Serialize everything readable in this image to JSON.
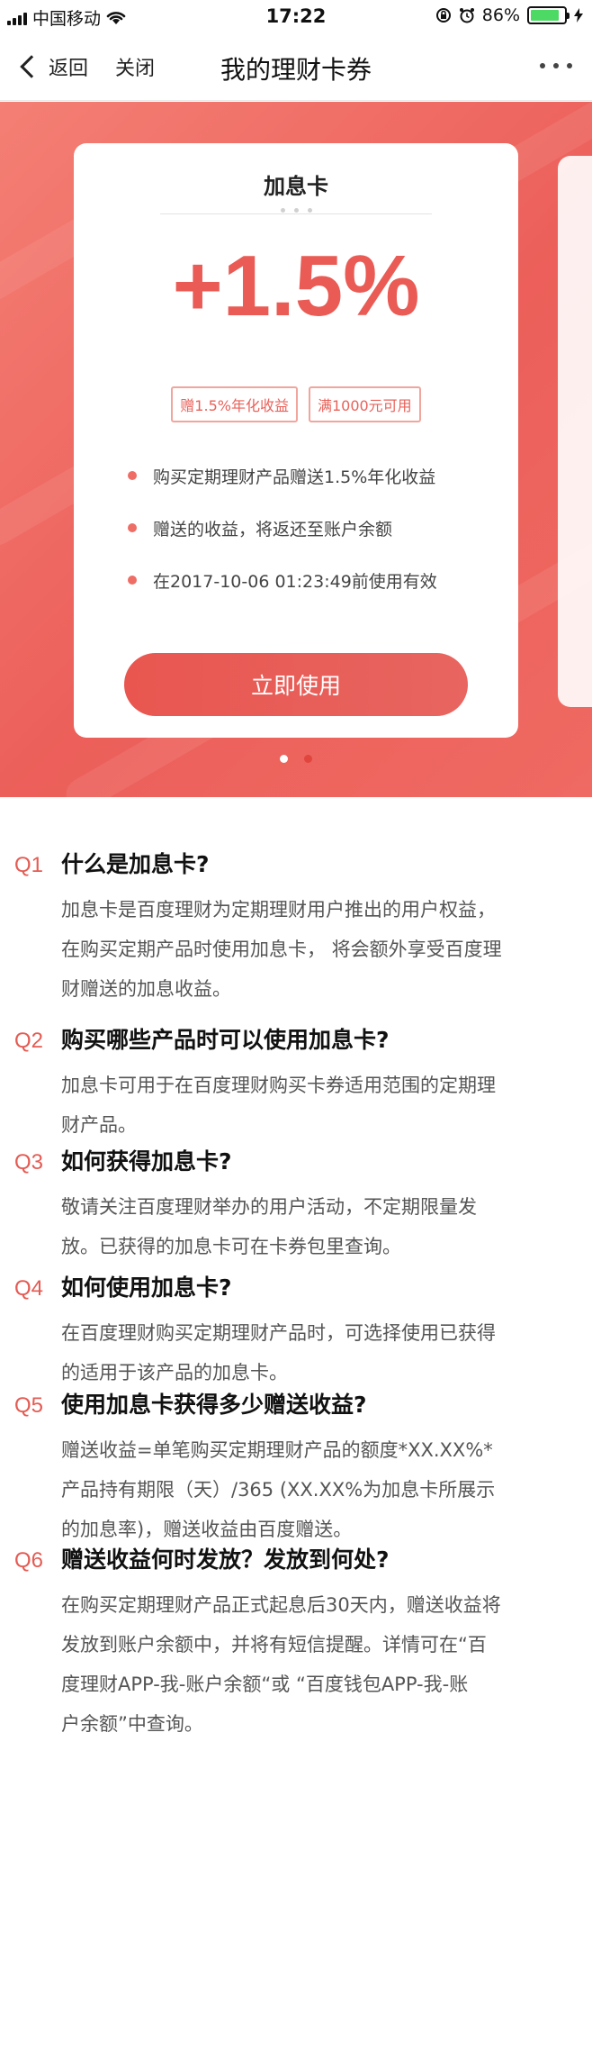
{
  "status_bar": {
    "carrier": "中国移动",
    "time": "17:22",
    "battery": "86%",
    "battery_level": 0.86
  },
  "nav": {
    "back_label": "返回",
    "close_label": "关闭",
    "title": "我的理财卡券",
    "more_icon": "ellipsis-icon"
  },
  "card": {
    "title": "加息卡",
    "rate": "+1.5%",
    "tags": [
      "赠1.5%年化收益",
      "满1000元可用"
    ],
    "rules": [
      "购买定期理财产品赠送1.5%年化收益",
      "赠送的收益，将返还至账户余额",
      "在2017-10-06 01:23:49前使用有效"
    ],
    "button_label": "立即使用"
  },
  "pager": {
    "count": 2,
    "active_index": 0
  },
  "colors": {
    "accent": "#e95b54",
    "banner_start": "#f47f74",
    "banner_end": "#ec5f5a"
  },
  "faq": [
    {
      "num": "Q1",
      "question": "什么是加息卡?",
      "answer_lines": [
        "加息卡是百度理财为定期理财用户推出的用户权益，",
        "在购买定期产品时使用加息卡， 将会额外享受百度理",
        "财赠送的加息收益。"
      ]
    },
    {
      "num": "Q2",
      "question": "购买哪些产品时可以使用加息卡?",
      "answer_lines": [
        "加息卡可用于在百度理财购买卡券适用范围的定期理",
        "财产品。"
      ]
    },
    {
      "num": "Q3",
      "question": "如何获得加息卡?",
      "answer_lines": [
        "敬请关注百度理财举办的用户活动，不定期限量发",
        "放。已获得的加息卡可在卡券包里查询。"
      ]
    },
    {
      "num": "Q4",
      "question": "如何使用加息卡?",
      "answer_lines": [
        "在百度理财购买定期理财产品时，可选择使用已获得",
        "的适用于该产品的加息卡。"
      ]
    },
    {
      "num": "Q5",
      "question": "使用加息卡获得多少赠送收益?",
      "answer_lines": [
        "赠送收益=单笔购买定期理财产品的额度*XX.XX%*",
        "产品持有期限（天）/365 (XX.XX%为加息卡所展示",
        "的加息率)，赠送收益由百度赠送。"
      ]
    },
    {
      "num": "Q6",
      "question": "赠送收益何时发放？发放到何处?",
      "answer_lines": [
        "在购买定期理财产品正式起息后30天内，赠送收益将",
        "发放到账户余额中，并将有短信提醒。详情可在“百",
        "度理财APP-我-账户余额“或 “百度钱包APP-我-账",
        "户余额”中查询。"
      ]
    }
  ]
}
